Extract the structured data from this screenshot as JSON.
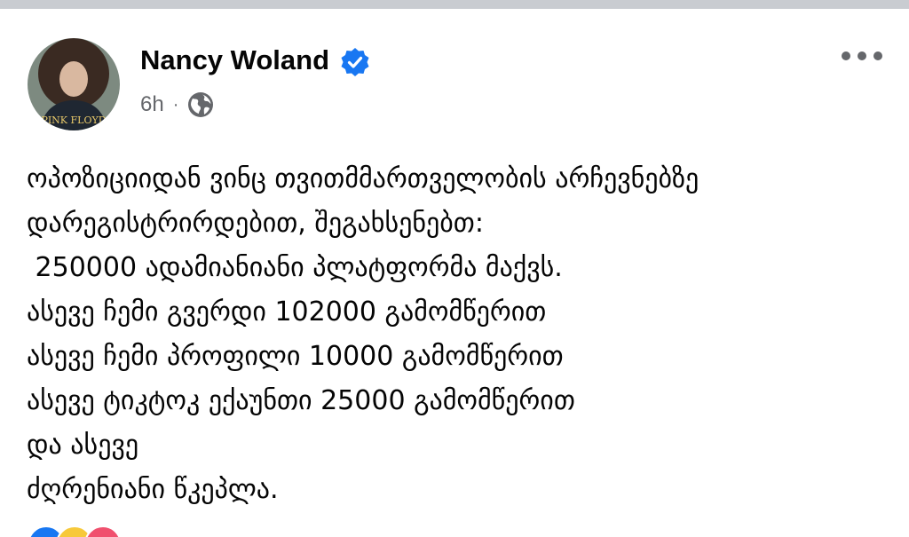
{
  "post": {
    "author": "Nancy Woland",
    "verified": true,
    "timestamp": "6h",
    "separator": "·",
    "privacy_icon": "globe-icon",
    "more_icon": "more-options-icon",
    "lines": [
      "ოპოზიციიდან ვინც თვითმმართველობის არჩევნებზე",
      "დარეგისტრირდებით, შეგახსენებთ:",
      " 250000 ადამიანიანი პლატფორმა მაქვს.",
      "ასევე ჩემი გვერდი 102000 გამომწერით",
      "ასევე ჩემი პროფილი 10000 გამომწერით",
      "ასევე ტიკტოკ ექაუნთი 25000 გამომწერით",
      "და ასევე",
      "ძღრენიანი წკეპლა."
    ],
    "reactions": [
      "like-reaction-icon",
      "haha-reaction-icon",
      "love-reaction-icon"
    ]
  },
  "colors": {
    "text": "#050505",
    "secondary": "#65676b",
    "verified_blue": "#1877f2",
    "top_bar": "#c9ccd1"
  }
}
